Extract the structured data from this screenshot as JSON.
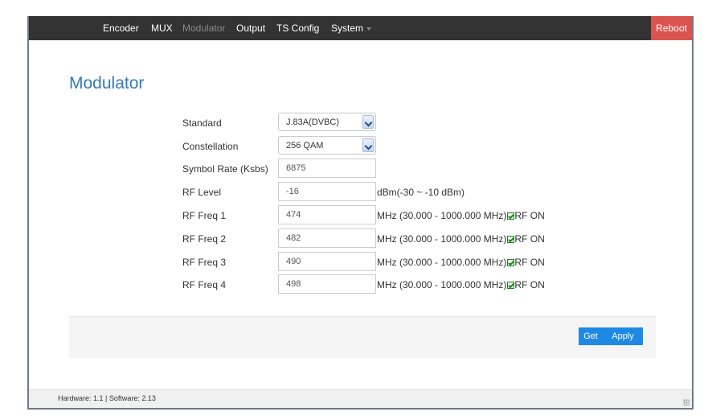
{
  "nav": {
    "items": [
      {
        "label": "Encoder",
        "disabled": false
      },
      {
        "label": "MUX",
        "disabled": false
      },
      {
        "label": "Modulator",
        "disabled": true
      },
      {
        "label": "Output",
        "disabled": false
      },
      {
        "label": "TS Config",
        "disabled": false
      },
      {
        "label": "System",
        "disabled": false
      }
    ],
    "reboot_label": "Reboot"
  },
  "page": {
    "title": "Modulator"
  },
  "form": {
    "standard": {
      "label": "Standard",
      "value": "J.83A(DVBC)"
    },
    "constellation": {
      "label": "Constellation",
      "value": "256 QAM"
    },
    "symbol_rate": {
      "label": "Symbol Rate (Ksbs)",
      "value": "6875"
    },
    "rf_level": {
      "label": "RF Level",
      "value": "-16",
      "unit": "dBm(-30 ~ -10 dBm)"
    },
    "freqs": [
      {
        "label": "RF Freq 1",
        "value": "474",
        "unit": "MHz (30.000 - 1000.000 MHz)",
        "rf_on_label": "RF ON",
        "rf_on": true
      },
      {
        "label": "RF Freq 2",
        "value": "482",
        "unit": "MHz (30.000 - 1000.000 MHz)",
        "rf_on_label": "RF ON",
        "rf_on": true
      },
      {
        "label": "RF Freq 3",
        "value": "490",
        "unit": "MHz (30.000 - 1000.000 MHz)",
        "rf_on_label": "RF ON",
        "rf_on": true
      },
      {
        "label": "RF Freq 4",
        "value": "498",
        "unit": "MHz (30.000 - 1000.000 MHz)",
        "rf_on_label": "RF ON",
        "rf_on": true
      }
    ]
  },
  "actions": {
    "get_label": "Get",
    "apply_label": "Apply"
  },
  "status": {
    "text": "Hardware: 1.1 | Software: 2.13"
  },
  "colors": {
    "navbar": "#333333",
    "reboot": "#d9534f",
    "title": "#337ab7",
    "button": "#1e88e5"
  }
}
